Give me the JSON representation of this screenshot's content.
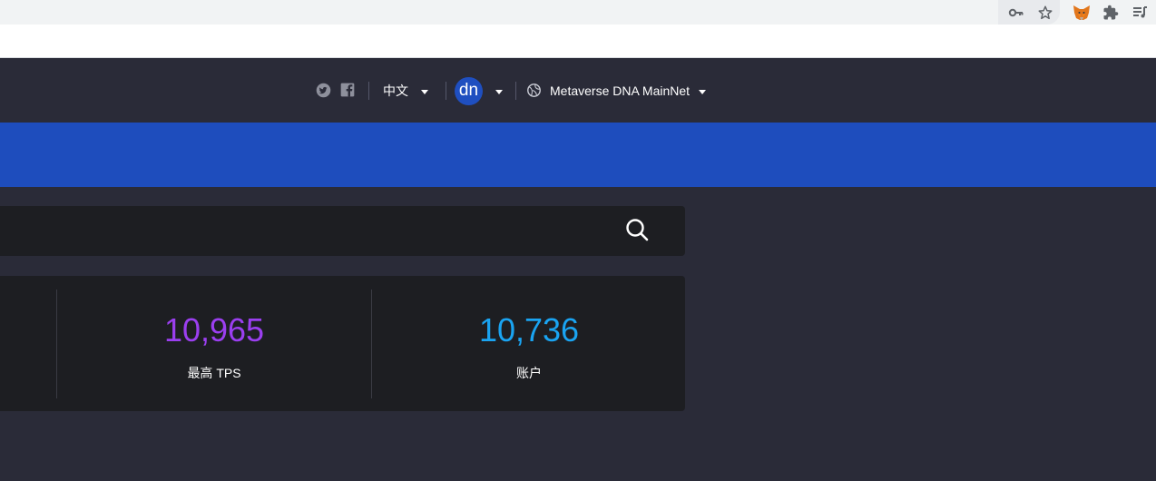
{
  "browser": {
    "toolbar_icons": [
      "key-icon",
      "star-icon",
      "metamask-fox-icon",
      "puzzle-icon",
      "media-list-icon"
    ]
  },
  "header": {
    "social_icons": [
      "twitter-icon",
      "facebook-icon"
    ],
    "language": "中文",
    "avatar_text": "dn",
    "network": "Metaverse DNA MainNet"
  },
  "search": {
    "value": "",
    "placeholder": ""
  },
  "stats": [
    {
      "value": "10,965",
      "label": "最高 TPS",
      "color": "#9b3ff0"
    },
    {
      "value": "10,736",
      "label": "账户",
      "color": "#1aa4f2"
    }
  ],
  "colors": {
    "header_bg": "#2a2b38",
    "banner_bg": "#1e4dbd",
    "panel_bg": "#1d1e22",
    "avatar_bg": "#1f4fc0"
  }
}
